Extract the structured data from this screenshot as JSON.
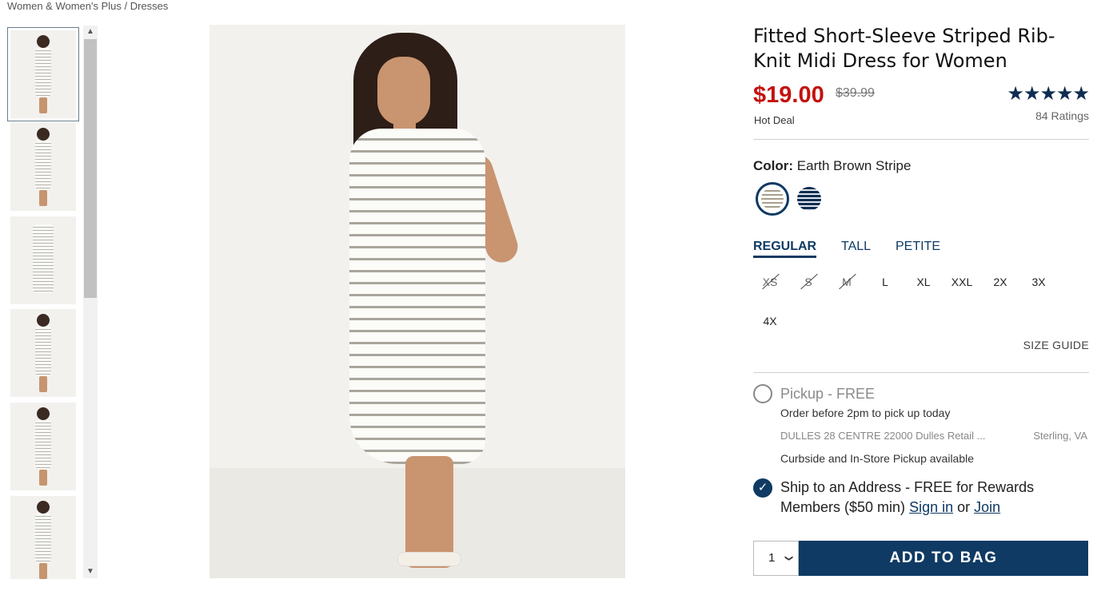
{
  "breadcrumb": "Women & Women's Plus / Dresses",
  "product": {
    "title": "Fitted Short-Sleeve Striped Rib-Knit Midi Dress for Women",
    "price": "$19.00",
    "original_price": "$39.99",
    "badge": "Hot Deal",
    "rating_stars": "★★★★★",
    "rating_value": 4.5,
    "ratings_count": "84 Ratings"
  },
  "color": {
    "label": "Color:",
    "selected": "Earth Brown Stripe",
    "swatches": [
      "earth-brown-stripe",
      "navy-stripe"
    ]
  },
  "fit_tabs": [
    "REGULAR",
    "TALL",
    "PETITE"
  ],
  "sizes": [
    {
      "label": "XS",
      "available": false
    },
    {
      "label": "S",
      "available": false
    },
    {
      "label": "M",
      "available": false
    },
    {
      "label": "L",
      "available": true
    },
    {
      "label": "XL",
      "available": true
    },
    {
      "label": "XXL",
      "available": true
    },
    {
      "label": "2X",
      "available": true
    },
    {
      "label": "3X",
      "available": true
    },
    {
      "label": "4X",
      "available": true
    }
  ],
  "size_guide": "SIZE GUIDE",
  "pickup": {
    "title": "Pickup - FREE",
    "subtitle": "Order before 2pm to pick up today",
    "store": "DULLES 28 CENTRE 22000 Dulles Retail ...",
    "city": "Sterling, VA",
    "availability": "Curbside and In-Store Pickup available"
  },
  "ship": {
    "text_before": "Ship to an Address - FREE for Rewards Members ($50 min)",
    "sign_in": "Sign in",
    "or": "or",
    "join": "Join"
  },
  "quantity": "1",
  "add_to_bag": "ADD TO BAG",
  "icons": {
    "scroll_up": "▲",
    "scroll_down": "▼",
    "check": "✓",
    "qty_chevron": "❯"
  }
}
